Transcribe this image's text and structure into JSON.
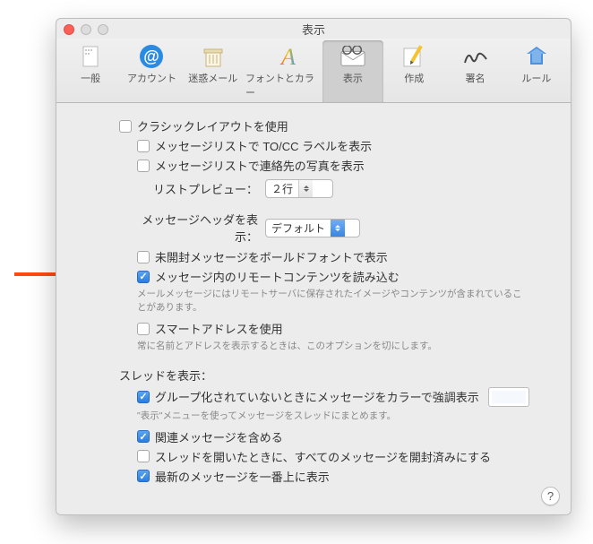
{
  "window": {
    "title": "表示"
  },
  "toolbar": {
    "items": [
      {
        "label": "一般"
      },
      {
        "label": "アカウント"
      },
      {
        "label": "迷惑メール"
      },
      {
        "label": "フォントとカラー"
      },
      {
        "label": "表示"
      },
      {
        "label": "作成"
      },
      {
        "label": "署名"
      },
      {
        "label": "ルール"
      }
    ]
  },
  "opts": {
    "classic_layout": "クラシックレイアウトを使用",
    "tocc_label": "メッセージリストで TO/CC ラベルを表示",
    "contact_photo": "メッセージリストで連絡先の写真を表示",
    "list_preview_label": "リストプレビュー：",
    "list_preview_value": "２行",
    "header_label": "メッセージヘッダを表示：",
    "header_value": "デフォルト",
    "bold_unread": "未開封メッセージをボールドフォントで表示",
    "remote_content": "メッセージ内のリモートコンテンツを読み込む",
    "remote_content_note": "メールメッセージにはリモートサーバに保存されたイメージやコンテンツが含まれていることがあります。",
    "smart_address": "スマートアドレスを使用",
    "smart_address_note": "常に名前とアドレスを表示するときは、このオプションを切にします。",
    "thread_header": "スレッドを表示：",
    "thread_color": "グループ化されていないときにメッセージをカラーで強調表示",
    "thread_color_note": "\"表示\"メニューを使ってメッセージをスレッドにまとめます。",
    "thread_related": "関連メッセージを含める",
    "thread_open_read": "スレッドを開いたときに、すべてのメッセージを開封済みにする",
    "thread_latest_top": "最新のメッセージを一番上に表示"
  },
  "help_symbol": "?"
}
